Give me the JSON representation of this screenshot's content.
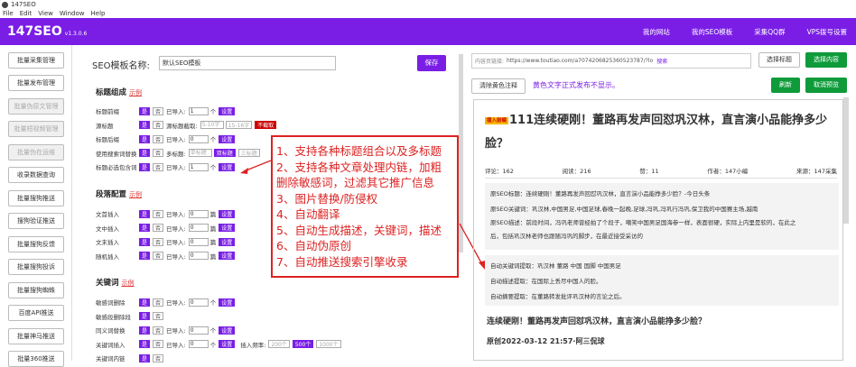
{
  "window": {
    "title": "147SEO"
  },
  "menu": [
    "File",
    "Edit",
    "View",
    "Window",
    "Help"
  ],
  "header": {
    "brand": "147SEO",
    "version": "v1.3.0.6",
    "nav": [
      "我的网站",
      "我的SEO模板",
      "采集QQ群",
      "VPS拨号设置"
    ]
  },
  "sidebar": [
    {
      "label": "批量采集管理",
      "disabled": false
    },
    {
      "label": "批量发布管理",
      "disabled": false
    },
    {
      "label": "批量伪原文管理",
      "disabled": true
    },
    {
      "label": "批量短视频管理",
      "disabled": true
    },
    {
      "label": "批量伪在运维",
      "disabled": true
    },
    {
      "label": "收录数据查询",
      "disabled": false
    },
    {
      "label": "批量搜狗推送",
      "disabled": false
    },
    {
      "label": "搜狗验证推送",
      "disabled": false
    },
    {
      "label": "批量搜狗反馈",
      "disabled": false
    },
    {
      "label": "批量搜狗投诉",
      "disabled": false
    },
    {
      "label": "批量搜狗蜘蛛",
      "disabled": false
    },
    {
      "label": "百度API推送",
      "disabled": false
    },
    {
      "label": "批量神马推送",
      "disabled": false
    },
    {
      "label": "批量360推送",
      "disabled": false
    }
  ],
  "template": {
    "name_label": "SEO模板名称:",
    "name_value": "默认SEO模板",
    "save": "保存"
  },
  "sections": {
    "title_group": {
      "title": "标题组成",
      "link": "示例"
    },
    "paragraph": {
      "title": "段落配置",
      "link": "示例"
    },
    "keyword": {
      "title": "关键词",
      "link": "示例"
    }
  },
  "title_rows": [
    {
      "label": "标题前缀",
      "a": "是",
      "b": "否",
      "t1": "已导入:",
      "v": "1",
      "u": "个",
      "btn": "设置"
    },
    {
      "label": "源标题",
      "a": "是",
      "b": "否",
      "t1": "源标题截取:",
      "v": "5-10字",
      "u": "15-16字",
      "btn": "不截取"
    },
    {
      "label": "标题后缀",
      "a": "是",
      "b": "否",
      "t1": "已导入:",
      "v": "0",
      "u": "个",
      "btn": "设置"
    },
    {
      "label": "使用搜索词替换",
      "a": "是",
      "b": "否",
      "t1": "多标题:",
      "v": "单标题",
      "u": "双标题",
      "btn": "三标题"
    },
    {
      "label": "标题必选包含词",
      "a": "是",
      "b": "否",
      "t1": "已导入:",
      "v": "1",
      "u": "个",
      "btn": "设置"
    }
  ],
  "para_rows": [
    {
      "label": "文首插入",
      "a": "是",
      "b": "否",
      "t1": "已导入:",
      "v": "0",
      "u": "篇",
      "btn": "设置"
    },
    {
      "label": "文中插入",
      "a": "是",
      "b": "否",
      "t1": "已导入:",
      "v": "0",
      "u": "篇",
      "btn": "设置"
    },
    {
      "label": "文末插入",
      "a": "是",
      "b": "否",
      "t1": "已导入:",
      "v": "0",
      "u": "篇",
      "btn": "设置"
    },
    {
      "label": "随机插入",
      "a": "是",
      "b": "否",
      "t1": "已导入:",
      "v": "0",
      "u": "篇",
      "btn": "设置"
    }
  ],
  "kw_rows": [
    {
      "label": "敏感词删除",
      "a": "是",
      "b": "否",
      "t1": "已导入:",
      "v": "0",
      "u": "个",
      "btn": "设置"
    },
    {
      "label": "敏感段删除段",
      "a": "是",
      "b": "否"
    },
    {
      "label": "同义词替换",
      "a": "是",
      "b": "否",
      "t1": "已导入:",
      "v": "0",
      "u": "个",
      "btn": "设置"
    },
    {
      "label": "关键词插入",
      "a": "是",
      "b": "否",
      "t1": "已导入:",
      "v": "0",
      "u": "个",
      "btn": "设置",
      "extra": "插入频率:",
      "f1": "200个",
      "f2": "500个",
      "f3": "1000个"
    },
    {
      "label": "关键词内链",
      "a": "是",
      "b": "否"
    }
  ],
  "annotation": [
    "1、支持各种标题组合以及多标题",
    "2、支持各种文章处理内链，加粗",
    "删除敏感词，过滤其它推广信息",
    "3、图片替换/防侵权",
    "4、自动翻译",
    "5、自动生成描述，关键词，描述",
    "6、自动伪原创",
    "7、自动推送搜索引擎收录"
  ],
  "preview": {
    "url_label": "内容页链接:",
    "url": "https://www.toutiao.com/a7074206825360523787/?lo",
    "url_btn": "搜索",
    "pick_title": "选择标题",
    "pick_content": "选择内容",
    "clear_yellow": "清除黄色注释",
    "hint": "黄色文字正式发布不显示。",
    "refresh": "刷新",
    "cancel": "取消预览",
    "badge": "插入前缀",
    "title": "111连续硬刚！董路再发声回怼巩汉林，直言演小品能挣多少脸？",
    "meta": [
      "评论：162",
      "阅读：216",
      "赞：11",
      "作者：147小编",
      "来源：147采集"
    ],
    "seo_title": "原SEO标题：连续硬刚！董路再发声回怼巩汉林，直言演小品能挣多少脸？-今日头条",
    "seo_kw": "原SEO关键词：巩汉林,中国男足,中国足球,春晚一起晚,足球,冯巩,冯巩行冯巩,保卫我的中国赛主场,越南",
    "seo_desc1": "原SEO描述：前段时间，冯巩老师曾经拍了个段子，嘲笑中国男足国海参一样，表面很硬，实际上内里是软的，在此之",
    "seo_desc2": "后，包括巩汉林老师也跟随冯巩的脚步，在最近接受采访的",
    "auto_kw": "自动关键词提取：巩汉林 董路 中国 国脚 中国男足",
    "auto_desc": "自动描述提取：在国际上丢尽中国人的脸。",
    "auto_sum": "自动摘要提取：在董路转发批评巩汉林的言论之后。",
    "subtitle": "连续硬刚！董路再发声回怼巩汉林，直言演小品能挣多少脸？",
    "byline": "原创2022-03-12 21:57·阿三侃球"
  }
}
